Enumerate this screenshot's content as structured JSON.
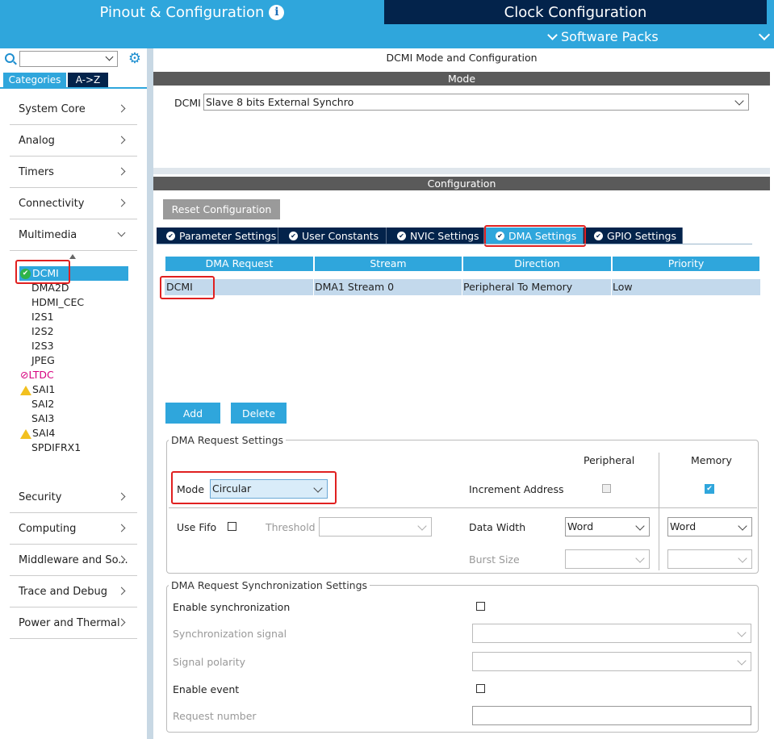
{
  "header": {
    "pinout_tab": "Pinout & Configuration",
    "clock_tab": "Clock Configuration",
    "software_packs": "Software Packs"
  },
  "sidebar": {
    "search_placeholder": "",
    "tab_categories": "Categories",
    "tab_az": "A->Z",
    "categories_top": [
      "System Core",
      "Analog",
      "Timers",
      "Connectivity",
      "Multimedia"
    ],
    "multimedia_items": [
      "DCMI",
      "DMA2D",
      "HDMI_CEC",
      "I2S1",
      "I2S2",
      "I2S3",
      "JPEG",
      "LTDC",
      "SAI1",
      "SAI2",
      "SAI3",
      "SAI4",
      "SPDIFRX1"
    ],
    "categories_bottom": [
      "Security",
      "Computing",
      "Middleware and So...",
      "Trace and Debug",
      "Power and Thermal"
    ]
  },
  "main": {
    "title": "DCMI Mode and Configuration",
    "mode_bar": "Mode",
    "mode_label": "DCMI",
    "mode_value": "Slave 8 bits External Synchro",
    "config_bar": "Configuration",
    "reset_button": "Reset Configuration",
    "tabs": [
      "Parameter Settings",
      "User Constants",
      "NVIC Settings",
      "DMA Settings",
      "GPIO Settings"
    ],
    "active_tab": "DMA Settings",
    "table": {
      "headers": [
        "DMA Request",
        "Stream",
        "Direction",
        "Priority"
      ],
      "rows": [
        [
          "DCMI",
          "DMA1 Stream 0",
          "Peripheral To Memory",
          "Low"
        ]
      ]
    },
    "add_button": "Add",
    "delete_button": "Delete"
  },
  "dma_request_settings": {
    "legend": "DMA Request Settings",
    "col_peripheral": "Peripheral",
    "col_memory": "Memory",
    "mode_label": "Mode",
    "mode_value": "Circular",
    "increment_label": "Increment Address",
    "use_fifo_label": "Use Fifo",
    "threshold_label": "Threshold",
    "threshold_value": "",
    "data_width_label": "Data Width",
    "peripheral_width": "Word",
    "memory_width": "Word",
    "burst_size_label": "Burst Size",
    "peripheral_burst": "",
    "memory_burst": ""
  },
  "sync_settings": {
    "legend": "DMA Request Synchronization Settings",
    "enable_sync_label": "Enable synchronization",
    "sync_signal_label": "Synchronization signal",
    "signal_polarity_label": "Signal polarity",
    "enable_event_label": "Enable event",
    "request_number_label": "Request number"
  },
  "colors": {
    "accent_blue": "#2fa6dc",
    "navy": "#03234b",
    "highlight_red": "#e02020",
    "ok_green": "#2eb34a",
    "warn_yellow": "#f2c01f",
    "error_magenta": "#d6007e"
  }
}
